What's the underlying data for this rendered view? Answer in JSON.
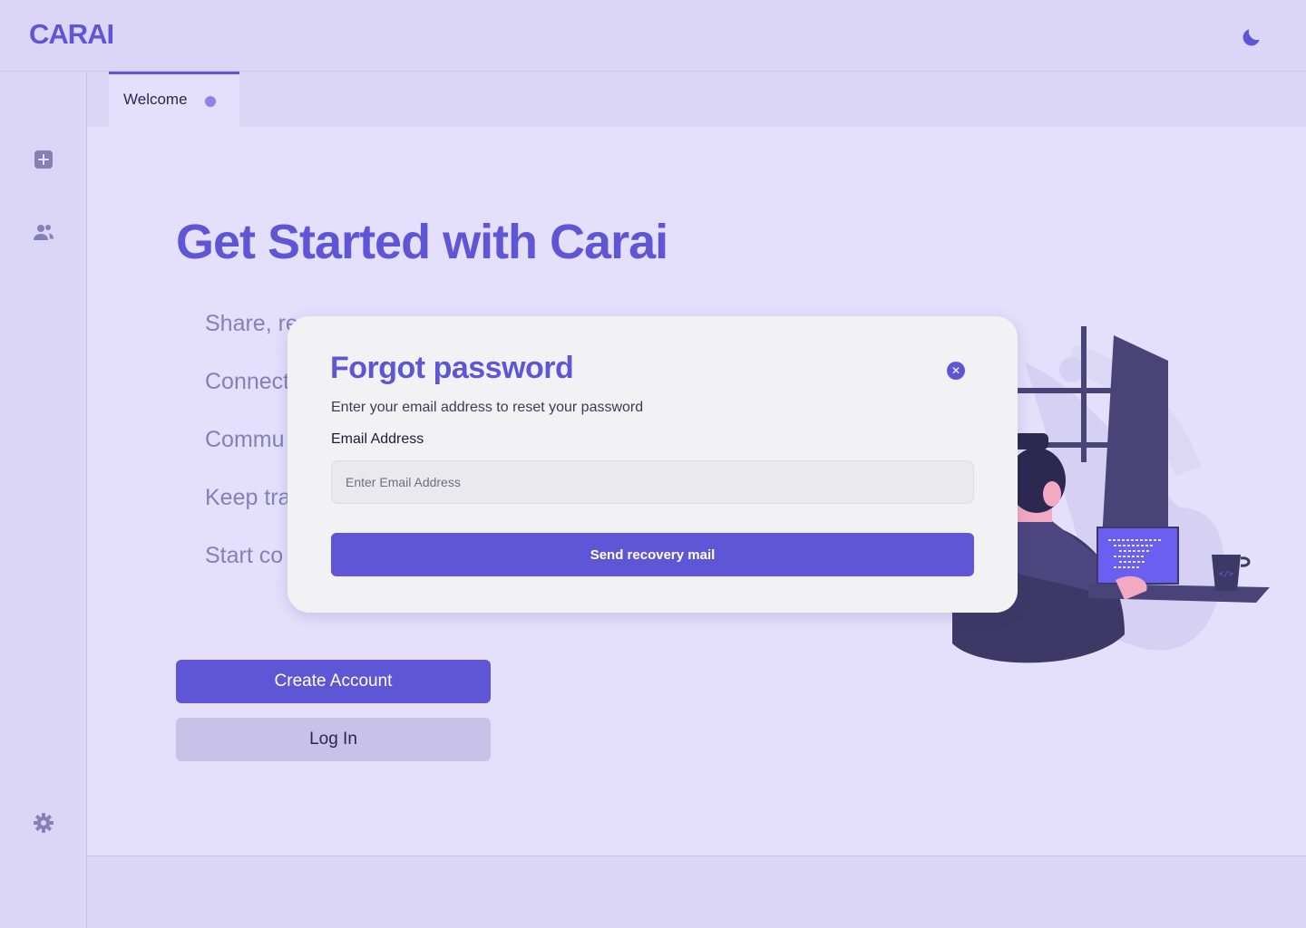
{
  "app": {
    "logo": "CARAI"
  },
  "header": {
    "theme_toggle_icon": "moon-icon"
  },
  "sidebar": {
    "items": [
      {
        "name": "new",
        "icon": "plus-square-icon"
      },
      {
        "name": "users",
        "icon": "users-icon"
      },
      {
        "name": "settings",
        "icon": "gear-icon"
      }
    ]
  },
  "tabs": [
    {
      "label": "Welcome",
      "active": true,
      "unsaved_dot": true
    }
  ],
  "hero": {
    "title": "Get Started with Carai",
    "features_visible": [
      "Share, re",
      "Connect",
      "Commu",
      "Keep tra",
      "Start co"
    ]
  },
  "actions": {
    "create_account": "Create Account",
    "log_in": "Log In"
  },
  "modal": {
    "title": "Forgot password",
    "close_symbol": "✕",
    "subtitle": "Enter your email address to reset your password",
    "email_label": "Email Address",
    "email_value": "",
    "email_placeholder": "Enter Email Address",
    "submit_label": "Send recovery mail"
  },
  "colors": {
    "accent": "#5f56d6",
    "background": "#e4e0fb",
    "panel": "#dcd6f6",
    "modal": "#f2f2f4",
    "secondary_button": "#c8c2e9"
  }
}
